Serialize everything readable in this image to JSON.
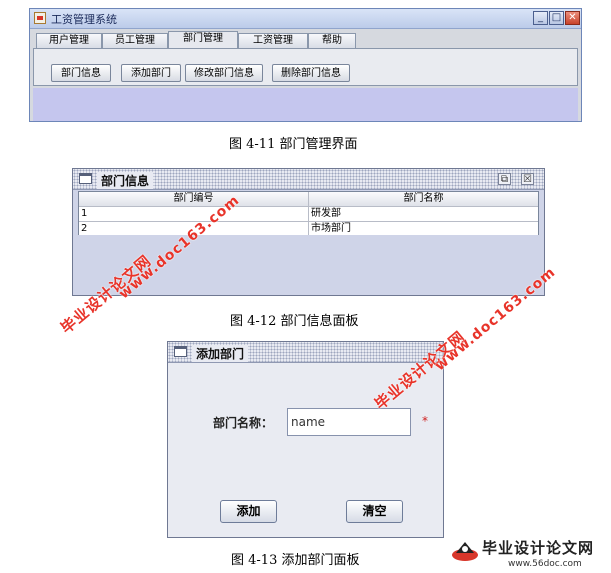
{
  "main_window": {
    "title": "工资管理系统",
    "controls": {
      "minimize": "_",
      "maximize": "□",
      "close": "✕"
    },
    "tabs": [
      {
        "label": "用户管理",
        "active": false
      },
      {
        "label": "员工管理",
        "active": false
      },
      {
        "label": "部门管理",
        "active": true
      },
      {
        "label": "工资管理",
        "active": false
      },
      {
        "label": "帮助",
        "active": false
      }
    ],
    "toolbar": [
      "部门信息",
      "添加部门",
      "修改部门信息",
      "删除部门信息"
    ]
  },
  "captions": {
    "fig1": "图 4-11  部门管理界面",
    "fig2": "图 4-12  部门信息面板",
    "fig3": "图 4-13  添加部门面板"
  },
  "dept_info_frame": {
    "title": "部门信息",
    "controls": {
      "restore": "⧉",
      "close": "☒"
    },
    "columns": [
      "部门编号",
      "部门名称"
    ],
    "rows": [
      [
        "1",
        "研发部"
      ],
      [
        "2",
        "市场部门"
      ]
    ]
  },
  "add_dept_frame": {
    "title": "添加部门",
    "label": "部门名称：",
    "input_value": "name",
    "required_mark": "*",
    "add_button": "添加",
    "clear_button": "清空"
  },
  "watermarks": {
    "site_name": "毕业设计论文网",
    "url": "www.doc163.com"
  },
  "logo": {
    "text": "毕业设计论文网",
    "url": "www.56doc.com"
  },
  "colors": {
    "watermark": "#e8342a",
    "lower_panel": "#c5c6ee",
    "frame_bg": "#cfd4e8"
  }
}
